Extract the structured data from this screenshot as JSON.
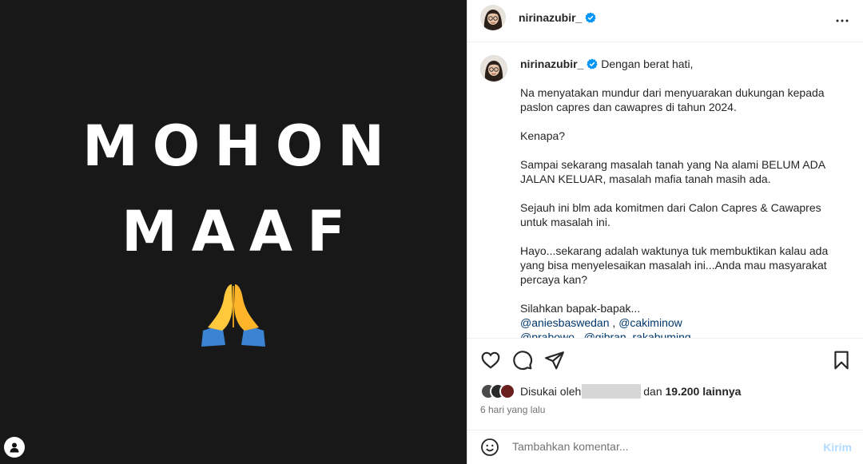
{
  "media": {
    "line1": "MOHON",
    "line2": "MAAF",
    "emoji": "folded-hands"
  },
  "header": {
    "username": "nirinazubir_",
    "verified": true,
    "more_icon": "more-horizontal-icon"
  },
  "caption": {
    "username": "nirinazubir_",
    "first_line": "Dengan berat hati,",
    "paragraphs": [
      "Na menyatakan mundur dari menyuarakan dukungan kepada paslon capres dan cawapres di tahun 2024.",
      "Kenapa?",
      "Sampai sekarang masalah tanah yang Na alami BELUM ADA JALAN KELUAR, masalah mafia tanah masih ada.",
      "Sejauh ini blm ada komitmen dari Calon Capres & Cawapres untuk masalah ini.",
      "Hayo...sekarang adalah waktunya tuk membuktikan kalau ada yang bisa menyelesaikan masalah ini...Anda mau masyarakat percaya kan?"
    ],
    "closing": "Silahkan bapak-bapak...",
    "mention1": "@aniesbaswedan",
    "mention_sep": " , ",
    "mention2": "@cakiminow",
    "mention_partial": "@prabowo , @gibran_rakabuming"
  },
  "actions": {
    "like_icon": "heart-icon",
    "comment_icon": "comment-icon",
    "share_icon": "send-icon",
    "save_icon": "bookmark-icon"
  },
  "likes": {
    "prefix": "Disukai oleh",
    "middle": "dan",
    "count": "19.200 lainnya"
  },
  "timestamp": "6 hari yang lalu",
  "comment": {
    "placeholder": "Tambahkan komentar...",
    "post_label": "Kirim",
    "emoji_icon": "smiley-icon"
  },
  "colors": {
    "verified": "#0095f6",
    "mention": "#00376b",
    "post_disabled": "#b3dbff",
    "media_bg": "#181818"
  }
}
